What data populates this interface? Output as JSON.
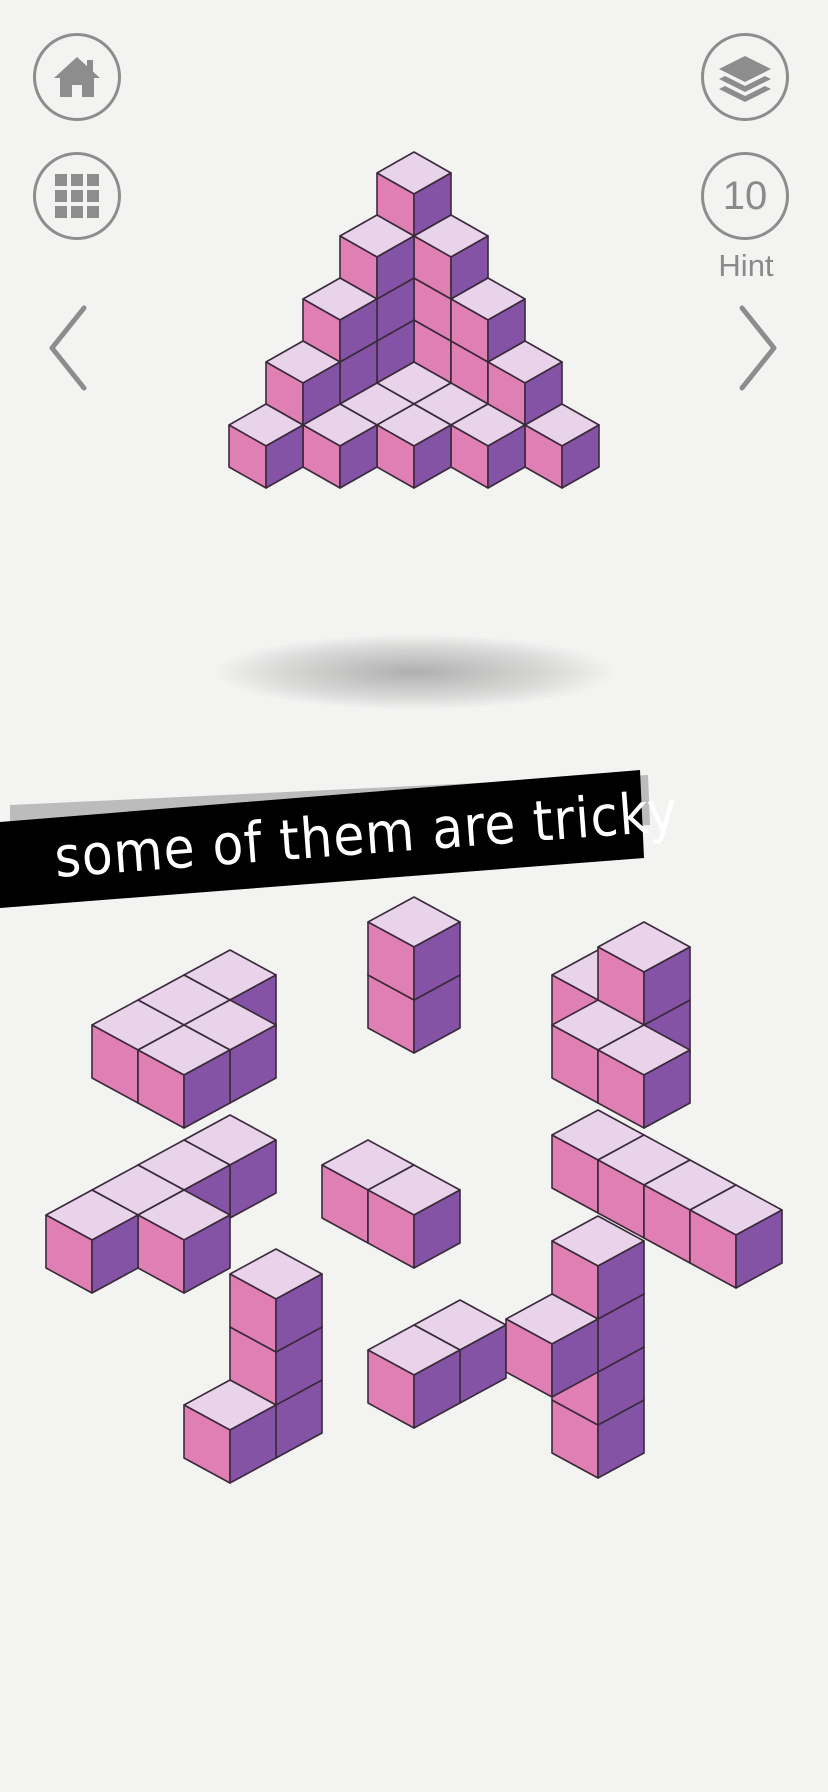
{
  "toolbar": {
    "home_icon": "home-icon",
    "levels_icon": "grid-icon",
    "layers_icon": "layers-icon",
    "hint_count": "10",
    "hint_label": "Hint",
    "prev_icon": "chevron-left-icon",
    "next_icon": "chevron-right-icon"
  },
  "banner": {
    "text": "some of them are tricky"
  },
  "colors": {
    "background": "#f3f3f2",
    "cube_top": "#e8d3ea",
    "cube_left": "#e07fb3",
    "cube_right": "#8453a6",
    "banner": "#000000",
    "icon_gray": "#8d8d8d"
  },
  "puzzle": {
    "target_shape": "stepped pyramid",
    "piece_count": 10
  }
}
